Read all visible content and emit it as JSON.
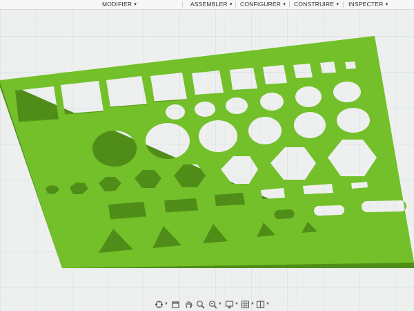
{
  "menu": {
    "items": [
      {
        "label": "MODIFIER"
      },
      {
        "label": "ASSEMBLER"
      },
      {
        "label": "CONFIGURER"
      },
      {
        "label": "CONSTRUIRE"
      },
      {
        "label": "INSPECTER"
      }
    ]
  },
  "viewport": {
    "plate_color": "#73c02a",
    "plate_shadow_color": "#4f8d18",
    "cutout_color": "#eeefef",
    "grid_color": "#d9dcdc"
  },
  "navigation_bar": {
    "tools": [
      {
        "icon": "orbit-icon"
      },
      {
        "icon": "look-at-icon"
      },
      {
        "icon": "pan-hand-icon"
      },
      {
        "icon": "zoom-icon"
      },
      {
        "icon": "zoom-window-icon"
      },
      {
        "icon": "display-settings-icon"
      },
      {
        "icon": "grid-settings-icon"
      },
      {
        "icon": "viewports-icon"
      }
    ]
  }
}
